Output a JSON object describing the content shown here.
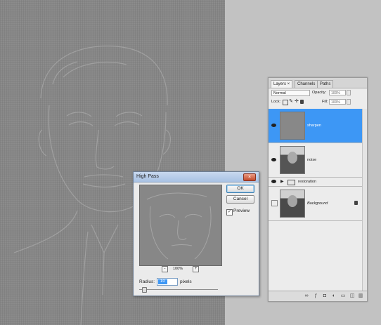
{
  "layers_panel": {
    "tabs": [
      "Layers ×",
      "Channels",
      "Paths"
    ],
    "blend_mode": "Normal",
    "opacity_label": "Opacity:",
    "opacity_value": "100%",
    "lock_label": "Lock:",
    "fill_label": "Fill:",
    "fill_value": "100%",
    "layers": [
      {
        "name": "sharpen",
        "selected": true
      },
      {
        "name": "noise",
        "selected": false
      },
      {
        "name": "restoration",
        "type": "group"
      },
      {
        "name": "Background",
        "locked": true
      }
    ],
    "footer_icons": [
      "link-icon",
      "fx-icon",
      "mask-icon",
      "adjustment-icon",
      "folder-icon",
      "new-layer-icon",
      "trash-icon"
    ]
  },
  "dialog": {
    "title": "High Pass",
    "close_label": "×",
    "ok_label": "OK",
    "cancel_label": "Cancel",
    "preview_label": "Preview",
    "preview_checked": true,
    "zoom_value": "100%",
    "zoom_out_label": "-",
    "zoom_in_label": "+",
    "radius_label": "Radius:",
    "radius_value": "10",
    "radius_unit": "pixels"
  },
  "colors": {
    "selection_blue": "#3d97f5",
    "canvas_gray": "#8c8c8c"
  }
}
